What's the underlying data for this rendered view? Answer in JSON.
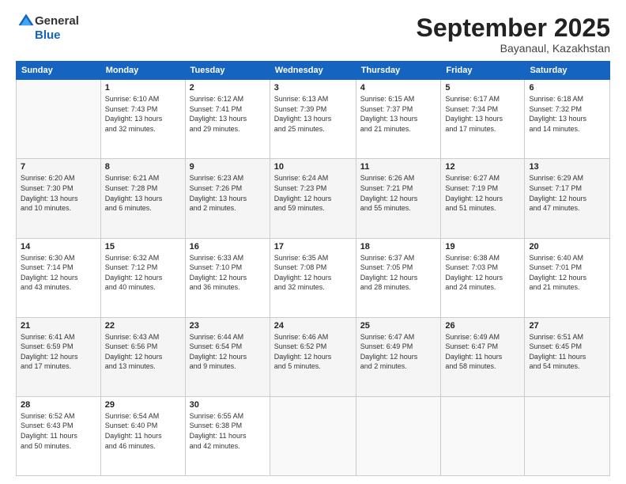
{
  "logo": {
    "general": "General",
    "blue": "Blue"
  },
  "header": {
    "month": "September 2025",
    "location": "Bayanaul, Kazakhstan"
  },
  "weekdays": [
    "Sunday",
    "Monday",
    "Tuesday",
    "Wednesday",
    "Thursday",
    "Friday",
    "Saturday"
  ],
  "weeks": [
    [
      {
        "day": "",
        "info": ""
      },
      {
        "day": "1",
        "info": "Sunrise: 6:10 AM\nSunset: 7:43 PM\nDaylight: 13 hours\nand 32 minutes."
      },
      {
        "day": "2",
        "info": "Sunrise: 6:12 AM\nSunset: 7:41 PM\nDaylight: 13 hours\nand 29 minutes."
      },
      {
        "day": "3",
        "info": "Sunrise: 6:13 AM\nSunset: 7:39 PM\nDaylight: 13 hours\nand 25 minutes."
      },
      {
        "day": "4",
        "info": "Sunrise: 6:15 AM\nSunset: 7:37 PM\nDaylight: 13 hours\nand 21 minutes."
      },
      {
        "day": "5",
        "info": "Sunrise: 6:17 AM\nSunset: 7:34 PM\nDaylight: 13 hours\nand 17 minutes."
      },
      {
        "day": "6",
        "info": "Sunrise: 6:18 AM\nSunset: 7:32 PM\nDaylight: 13 hours\nand 14 minutes."
      }
    ],
    [
      {
        "day": "7",
        "info": "Sunrise: 6:20 AM\nSunset: 7:30 PM\nDaylight: 13 hours\nand 10 minutes."
      },
      {
        "day": "8",
        "info": "Sunrise: 6:21 AM\nSunset: 7:28 PM\nDaylight: 13 hours\nand 6 minutes."
      },
      {
        "day": "9",
        "info": "Sunrise: 6:23 AM\nSunset: 7:26 PM\nDaylight: 13 hours\nand 2 minutes."
      },
      {
        "day": "10",
        "info": "Sunrise: 6:24 AM\nSunset: 7:23 PM\nDaylight: 12 hours\nand 59 minutes."
      },
      {
        "day": "11",
        "info": "Sunrise: 6:26 AM\nSunset: 7:21 PM\nDaylight: 12 hours\nand 55 minutes."
      },
      {
        "day": "12",
        "info": "Sunrise: 6:27 AM\nSunset: 7:19 PM\nDaylight: 12 hours\nand 51 minutes."
      },
      {
        "day": "13",
        "info": "Sunrise: 6:29 AM\nSunset: 7:17 PM\nDaylight: 12 hours\nand 47 minutes."
      }
    ],
    [
      {
        "day": "14",
        "info": "Sunrise: 6:30 AM\nSunset: 7:14 PM\nDaylight: 12 hours\nand 43 minutes."
      },
      {
        "day": "15",
        "info": "Sunrise: 6:32 AM\nSunset: 7:12 PM\nDaylight: 12 hours\nand 40 minutes."
      },
      {
        "day": "16",
        "info": "Sunrise: 6:33 AM\nSunset: 7:10 PM\nDaylight: 12 hours\nand 36 minutes."
      },
      {
        "day": "17",
        "info": "Sunrise: 6:35 AM\nSunset: 7:08 PM\nDaylight: 12 hours\nand 32 minutes."
      },
      {
        "day": "18",
        "info": "Sunrise: 6:37 AM\nSunset: 7:05 PM\nDaylight: 12 hours\nand 28 minutes."
      },
      {
        "day": "19",
        "info": "Sunrise: 6:38 AM\nSunset: 7:03 PM\nDaylight: 12 hours\nand 24 minutes."
      },
      {
        "day": "20",
        "info": "Sunrise: 6:40 AM\nSunset: 7:01 PM\nDaylight: 12 hours\nand 21 minutes."
      }
    ],
    [
      {
        "day": "21",
        "info": "Sunrise: 6:41 AM\nSunset: 6:59 PM\nDaylight: 12 hours\nand 17 minutes."
      },
      {
        "day": "22",
        "info": "Sunrise: 6:43 AM\nSunset: 6:56 PM\nDaylight: 12 hours\nand 13 minutes."
      },
      {
        "day": "23",
        "info": "Sunrise: 6:44 AM\nSunset: 6:54 PM\nDaylight: 12 hours\nand 9 minutes."
      },
      {
        "day": "24",
        "info": "Sunrise: 6:46 AM\nSunset: 6:52 PM\nDaylight: 12 hours\nand 5 minutes."
      },
      {
        "day": "25",
        "info": "Sunrise: 6:47 AM\nSunset: 6:49 PM\nDaylight: 12 hours\nand 2 minutes."
      },
      {
        "day": "26",
        "info": "Sunrise: 6:49 AM\nSunset: 6:47 PM\nDaylight: 11 hours\nand 58 minutes."
      },
      {
        "day": "27",
        "info": "Sunrise: 6:51 AM\nSunset: 6:45 PM\nDaylight: 11 hours\nand 54 minutes."
      }
    ],
    [
      {
        "day": "28",
        "info": "Sunrise: 6:52 AM\nSunset: 6:43 PM\nDaylight: 11 hours\nand 50 minutes."
      },
      {
        "day": "29",
        "info": "Sunrise: 6:54 AM\nSunset: 6:40 PM\nDaylight: 11 hours\nand 46 minutes."
      },
      {
        "day": "30",
        "info": "Sunrise: 6:55 AM\nSunset: 6:38 PM\nDaylight: 11 hours\nand 42 minutes."
      },
      {
        "day": "",
        "info": ""
      },
      {
        "day": "",
        "info": ""
      },
      {
        "day": "",
        "info": ""
      },
      {
        "day": "",
        "info": ""
      }
    ]
  ]
}
